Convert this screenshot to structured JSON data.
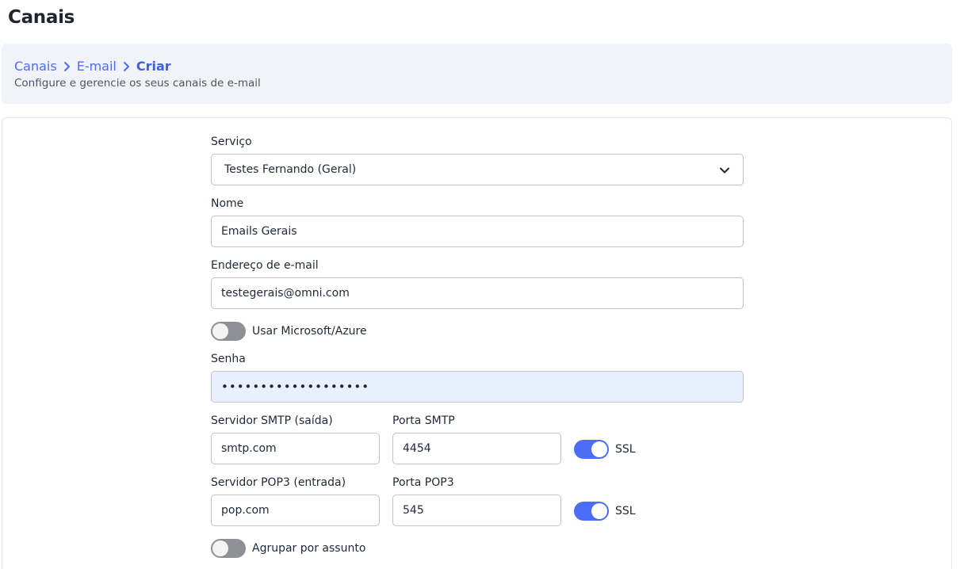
{
  "page": {
    "title": "Canais"
  },
  "breadcrumb": {
    "items": [
      "Canais",
      "E-mail"
    ],
    "current": "Criar",
    "subtitle": "Configure e gerencie os seus canais de e-mail"
  },
  "form": {
    "servico": {
      "label": "Serviço",
      "value": "Testes Fernando (Geral)"
    },
    "nome": {
      "label": "Nome",
      "value": "Emails Gerais"
    },
    "email": {
      "label": "Endereço de e-mail",
      "value": "testegerais@omni.com"
    },
    "azure": {
      "label": "Usar Microsoft/Azure",
      "on": false
    },
    "senha": {
      "label": "Senha",
      "value": "•••••••••••••••••••"
    },
    "smtp_server": {
      "label": "Servidor SMTP (saída)",
      "value": "smtp.com"
    },
    "smtp_port": {
      "label": "Porta SMTP",
      "value": "4454"
    },
    "smtp_ssl": {
      "label": "SSL",
      "on": true
    },
    "pop3_server": {
      "label": "Servidor POP3 (entrada)",
      "value": "pop.com"
    },
    "pop3_port": {
      "label": "Porta POP3",
      "value": "545"
    },
    "pop3_ssl": {
      "label": "SSL",
      "on": true
    },
    "group_subject": {
      "label": "Agrupar por assunto",
      "on": false
    }
  },
  "colors": {
    "accent": "#4a6cf7",
    "toggle_off": "#8e9097",
    "header_bg": "#f1f3f8",
    "autofill_bg": "#e8f0fe"
  },
  "icons": {
    "breadcrumb_separator": "chevron-right-icon",
    "select_arrow": "chevron-down-icon"
  }
}
